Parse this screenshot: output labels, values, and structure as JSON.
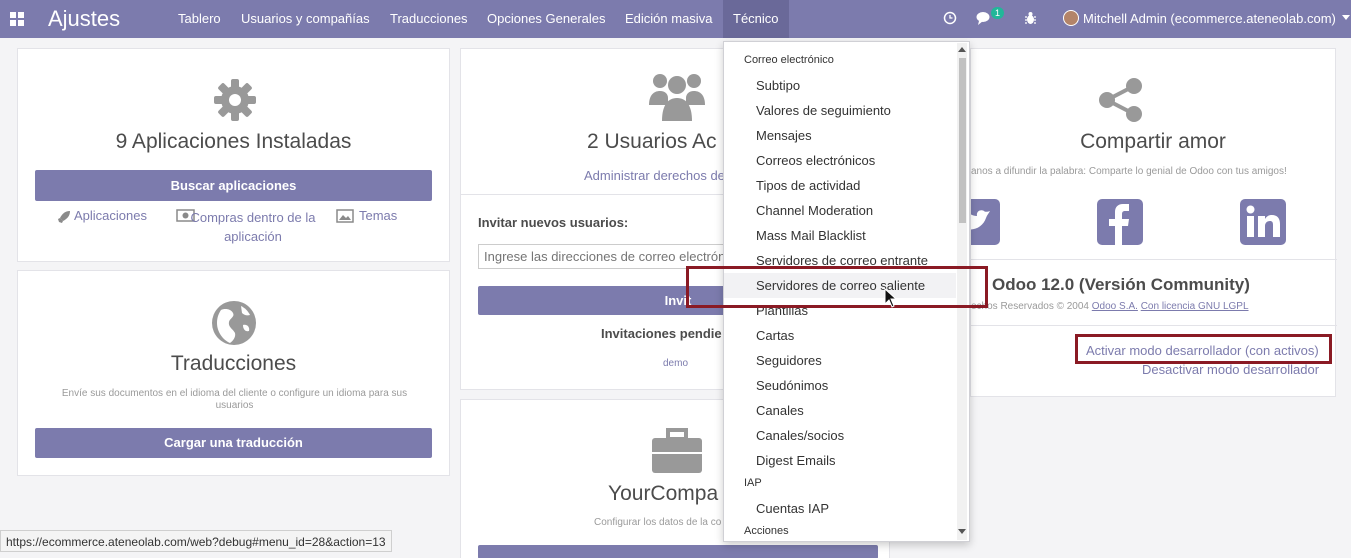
{
  "nav": {
    "app_title": "Ajustes",
    "menu": [
      "Tablero",
      "Usuarios y compañías",
      "Traducciones",
      "Opciones Generales",
      "Edición masiva",
      "Técnico"
    ],
    "chat_badge": "1",
    "user": "Mitchell Admin (ecommerce.ateneolab.com)"
  },
  "apps_card": {
    "title": "9 Aplicaciones Instaladas",
    "button": "Buscar aplicaciones",
    "link_apps": "Aplicaciones",
    "link_inapp": "Compras dentro de la aplicación",
    "link_themes": "Temas"
  },
  "users_card": {
    "title": "2 Usuarios Ac",
    "link": "Administrar derechos de",
    "invite_label": "Invitar nuevos usuarios:",
    "invite_placeholder": "Ingrese las direcciones de correo electrón",
    "invite_button": "Invit",
    "pending_label": "Invitaciones pendie",
    "pending_user": "demo"
  },
  "translations_card": {
    "title": "Traducciones",
    "subtitle": "Envíe sus documentos en el idioma del cliente o configure un idioma para sus usuarios",
    "button": "Cargar una traducción"
  },
  "company_card": {
    "title": "YourCompa",
    "subtitle": "Configurar los datos de la co"
  },
  "share_card": {
    "title": "Compartir amor",
    "subtitle": "anos a difundir la palabra: Comparte lo genial de Odoo con tus amigos!",
    "version": "Odoo 12.0 (Versión Community)",
    "rights_prefix": "echos Reservados © 2004",
    "odoo_link": "Odoo S.A.",
    "license_link": "Con licencia GNU LGPL",
    "dev_with_assets": "Activar modo desarrollador (con activos)",
    "dev_off": "Desactivar modo desarrollador"
  },
  "dropdown": {
    "header_email": "Correo electrónico",
    "email_items": [
      "Subtipo",
      "Valores de seguimiento",
      "Mensajes",
      "Correos electrónicos",
      "Tipos de actividad",
      "Channel Moderation",
      "Mass Mail Blacklist",
      "Servidores de correo entrante",
      "Servidores de correo saliente",
      "Plantillas",
      "Cartas",
      "Seguidores",
      "Seudónimos",
      "Canales",
      "Canales/socios",
      "Digest Emails"
    ],
    "header_iap": "IAP",
    "iap_items": [
      "Cuentas IAP"
    ],
    "header_actions": "Acciones"
  },
  "status_url": "https://ecommerce.ateneolab.com/web?debug#menu_id=28&action=13",
  "colors": {
    "brand": "#7c7bad",
    "highlight": "#8a1a24"
  }
}
